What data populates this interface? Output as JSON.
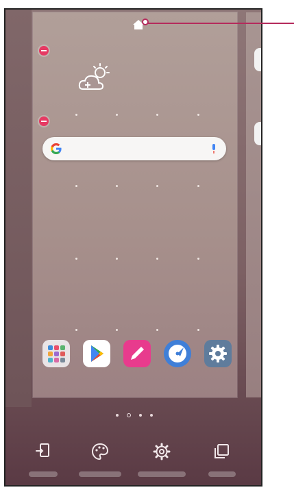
{
  "screen": {
    "accent": "#e63a63",
    "callout_color": "#b52a5c"
  },
  "home_panel": {
    "home_indicator_icon": "home-icon",
    "weather_icon": "weather-add-icon",
    "search": {
      "logo_icon": "google-g-icon",
      "mic_icon": "mic-icon"
    },
    "apps": [
      {
        "name": "folder-apps-icon",
        "color": "#e9e4e6"
      },
      {
        "name": "play-store-icon",
        "color": "#ffffff"
      },
      {
        "name": "pen-app-icon",
        "color": "#e83b8d"
      },
      {
        "name": "compass-app-icon",
        "color": "#3f7fd8"
      },
      {
        "name": "settings-app-icon",
        "color": "#5f7c9c"
      }
    ]
  },
  "page_indicator": {
    "count": 4,
    "current": 1
  },
  "bottom_bar": [
    {
      "icon": "move-icon"
    },
    {
      "icon": "palette-icon"
    },
    {
      "icon": "gear-icon"
    },
    {
      "icon": "copy-pages-icon"
    }
  ]
}
